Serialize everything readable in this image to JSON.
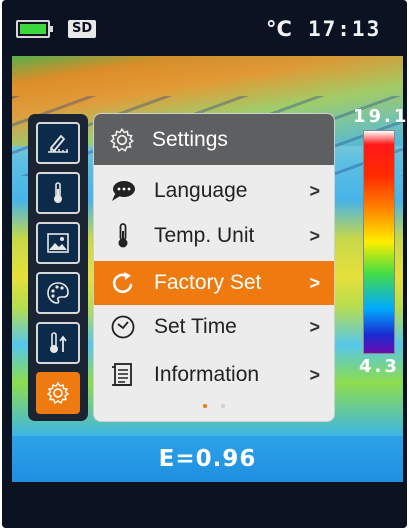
{
  "status_bar": {
    "sd_label": "SD",
    "temp_unit": "°C",
    "time": "17:13",
    "battery_level": 1.0
  },
  "color_scale": {
    "max_label": "19.1",
    "min_label": "4.3"
  },
  "side_toolbar": {
    "items": [
      {
        "icon": "measure-edit-icon"
      },
      {
        "icon": "thermometer-icon"
      },
      {
        "icon": "image-gallery-icon"
      },
      {
        "icon": "palette-icon"
      },
      {
        "icon": "temp-alarm-icon"
      },
      {
        "icon": "gear-icon",
        "active": true
      }
    ]
  },
  "settings_menu": {
    "title": "Settings",
    "items": [
      {
        "label": "Language",
        "icon": "language-bubble-icon",
        "chevron": ">"
      },
      {
        "label": "Temp. Unit",
        "icon": "thermometer-icon",
        "chevron": ">"
      },
      {
        "label": "Factory Set",
        "icon": "reset-arrow-icon",
        "chevron": ">",
        "selected": true
      },
      {
        "label": "Set Time",
        "icon": "clock-icon",
        "chevron": ">"
      },
      {
        "label": "Information",
        "icon": "document-icon",
        "chevron": ">"
      }
    ],
    "page_count": 2,
    "current_page": 1
  },
  "emissivity": {
    "label": "E=0.96"
  },
  "colors": {
    "accent": "#ee7a10",
    "header": "#5e5f61",
    "menu_bg": "#ececec"
  }
}
